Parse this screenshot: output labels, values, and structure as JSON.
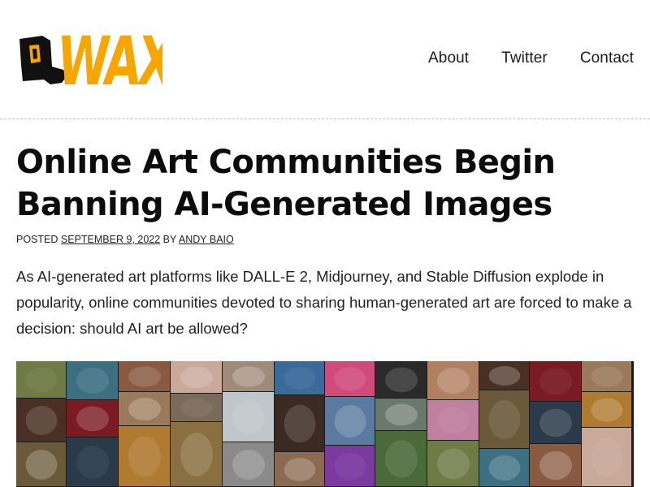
{
  "header": {
    "logo_text": "WAXY",
    "nav": [
      {
        "label": "About"
      },
      {
        "label": "Twitter"
      },
      {
        "label": "Contact"
      }
    ]
  },
  "article": {
    "title_line1": "Online Art Communities Begin",
    "title_line2": "Banning AI-Generated Images",
    "meta": {
      "posted_label": "Posted",
      "date": "September 9, 2022",
      "by_label": "by",
      "author": "Andy Baio"
    },
    "lead": "As AI-generated art platforms like DALL-E 2, Midjourney, and Stable Diffusion explode in popularity, online communities devoted to sharing human-generated art are forced to make a decision: should AI art be allowed?"
  },
  "colors": {
    "logo_orange": "#f7a600",
    "logo_black": "#111111",
    "text": "#111111",
    "divider": "#bdbdbd"
  },
  "collage_tiles": [
    {
      "name": "tree-landscape",
      "color": "#6f7a45"
    },
    {
      "name": "dark-figure",
      "color": "#4a3024"
    },
    {
      "name": "ornate-mask",
      "color": "#6a5a3a"
    },
    {
      "name": "ocean-ship",
      "color": "#3d6f82"
    },
    {
      "name": "red-cloak-figure",
      "color": "#7a1a22"
    },
    {
      "name": "neon-city",
      "color": "#2a3a4a"
    },
    {
      "name": "collage-faces",
      "color": "#8a5a40"
    },
    {
      "name": "portrait-woman",
      "color": "#9a7a5a"
    },
    {
      "name": "golden-statue",
      "color": "#b07a30"
    },
    {
      "name": "pale-figure",
      "color": "#caa89a"
    },
    {
      "name": "portrait-man-suit",
      "color": "#7a6a5a"
    },
    {
      "name": "village-scene",
      "color": "#8a7040"
    },
    {
      "name": "crowd-figures",
      "color": "#a08a7a"
    },
    {
      "name": "floating-island",
      "color": "#bfc7cc"
    },
    {
      "name": "armored-warrior",
      "color": "#8a8a8a"
    },
    {
      "name": "glowing-face",
      "color": "#3a6a9a"
    },
    {
      "name": "masked-hero",
      "color": "#3a2a22"
    },
    {
      "name": "muscular-figure",
      "color": "#8a6a50"
    },
    {
      "name": "pink-portrait",
      "color": "#d04a7a"
    },
    {
      "name": "blue-haired-woman",
      "color": "#5a7aa0"
    },
    {
      "name": "green-joker",
      "color": "#7a3aa0"
    },
    {
      "name": "hooded-figure",
      "color": "#2a2a2a"
    },
    {
      "name": "moody-landscape",
      "color": "#6a7a6a"
    },
    {
      "name": "ufo-beam",
      "color": "#4a6a3a"
    },
    {
      "name": "woman-portrait",
      "color": "#b08060"
    },
    {
      "name": "pink-creature",
      "color": "#c080a0"
    }
  ]
}
